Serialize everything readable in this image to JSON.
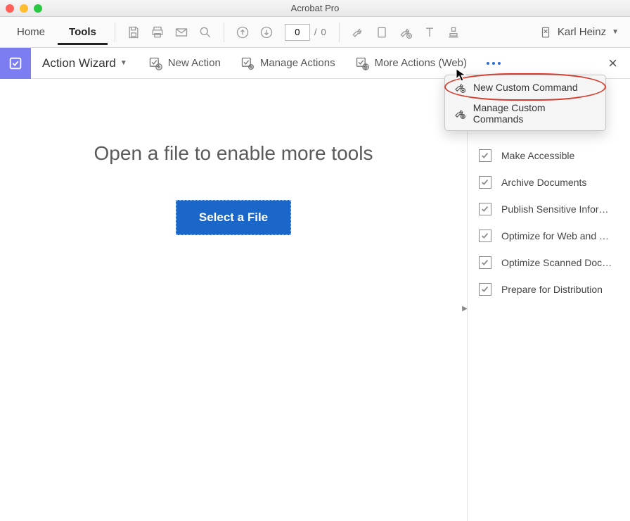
{
  "window_title": "Acrobat Pro",
  "tabs": {
    "home": "Home",
    "tools": "Tools"
  },
  "page": {
    "current": "0",
    "separator": "/",
    "total": "0"
  },
  "user_name": "Karl Heinz",
  "subbar": {
    "title": "Action Wizard",
    "new_action": "New Action",
    "manage_actions": "Manage Actions",
    "more_actions": "More Actions (Web)"
  },
  "popup": {
    "new_custom": "New Custom Command",
    "manage_custom": "Manage Custom Commands"
  },
  "main": {
    "prompt": "Open a file to enable more tools",
    "select_file": "Select a File"
  },
  "side_items": [
    "Make Accessible",
    "Archive Documents",
    "Publish Sensitive Inform…",
    "Optimize for Web and M…",
    "Optimize Scanned Docu…",
    "Prepare for Distribution"
  ]
}
